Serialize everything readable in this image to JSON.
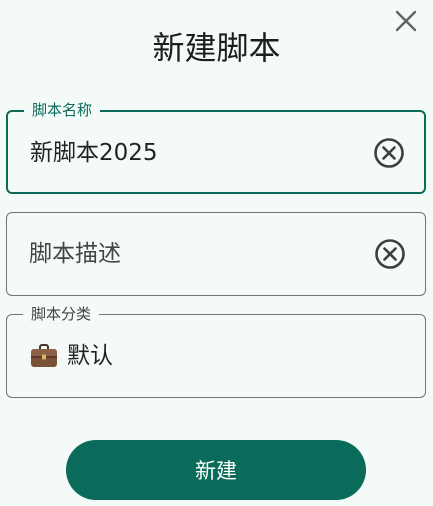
{
  "dialog": {
    "title": "新建脚本",
    "close_icon": "close-icon"
  },
  "fields": {
    "name": {
      "label": "脚本名称",
      "value": "新脚本2025",
      "clear_icon": "clear-circle-icon"
    },
    "description": {
      "placeholder": "脚本描述",
      "value": "",
      "clear_icon": "clear-circle-icon"
    },
    "category": {
      "label": "脚本分类",
      "icon": "briefcase-icon",
      "value": "默认"
    }
  },
  "actions": {
    "create_label": "新建"
  },
  "colors": {
    "accent": "#0b6b5a",
    "background": "#f4faf7",
    "outline": "#6f7572",
    "text": "#1e2422"
  }
}
